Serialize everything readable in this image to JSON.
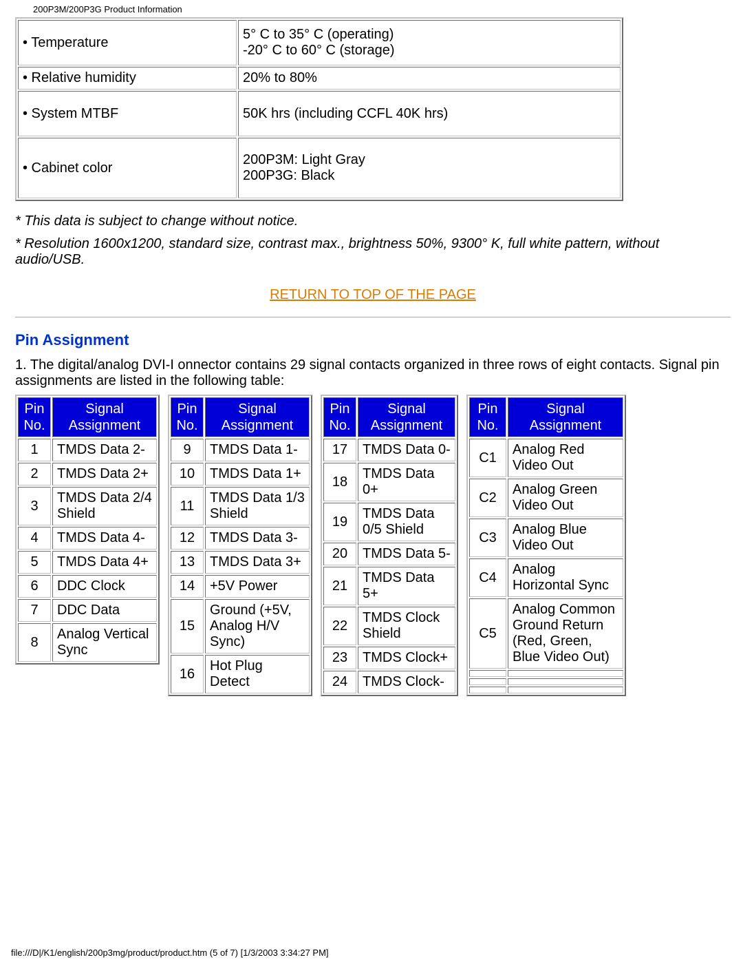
{
  "header": "200P3M/200P3G Product Information",
  "spec_table": {
    "rows": [
      {
        "label": "• Temperature",
        "value": "5° C to 35° C (operating)\n-20° C to 60° C (storage)",
        "cls": "tall"
      },
      {
        "label": "• Relative humidity",
        "value": "20% to 80%",
        "cls": ""
      },
      {
        "label": "• System MTBF",
        "value": "50K hrs (including CCFL 40K hrs)",
        "cls": "tall"
      },
      {
        "label": "• Cabinet color",
        "value": "200P3M: Light Gray\n200P3G: Black",
        "cls": "taller"
      }
    ]
  },
  "notes": [
    "* This data is subject to change without notice.",
    "* Resolution 1600x1200, standard size, contrast max., brightness 50%, 9300° K, full white pattern, without audio/USB."
  ],
  "return_link": "RETURN TO TOP OF THE PAGE",
  "section_title": "Pin Assignment",
  "intro": "1. The digital/analog DVI-I onnector contains 29 signal contacts organized in three rows of eight contacts. Signal pin assignments are listed in the following table:",
  "pin_headers": {
    "no": "Pin No.",
    "sig": "Signal Assignment"
  },
  "pin_cols": [
    [
      {
        "no": "1",
        "sig": "TMDS Data 2-"
      },
      {
        "no": "2",
        "sig": "TMDS Data 2+"
      },
      {
        "no": "3",
        "sig": "TMDS Data 2/4 Shield"
      },
      {
        "no": "4",
        "sig": "TMDS Data 4-"
      },
      {
        "no": "5",
        "sig": "TMDS Data 4+"
      },
      {
        "no": "6",
        "sig": "DDC Clock"
      },
      {
        "no": "7",
        "sig": "DDC Data"
      },
      {
        "no": "8",
        "sig": "Analog Vertical Sync"
      }
    ],
    [
      {
        "no": "9",
        "sig": "TMDS Data 1-"
      },
      {
        "no": "10",
        "sig": "TMDS Data 1+"
      },
      {
        "no": "11",
        "sig": "TMDS Data 1/3 Shield"
      },
      {
        "no": "12",
        "sig": "TMDS Data 3-"
      },
      {
        "no": "13",
        "sig": "TMDS Data 3+"
      },
      {
        "no": "14",
        "sig": "+5V Power"
      },
      {
        "no": "15",
        "sig": "Ground (+5V, Analog H/V Sync)"
      },
      {
        "no": "16",
        "sig": "Hot Plug Detect"
      }
    ],
    [
      {
        "no": "17",
        "sig": "TMDS Data 0-"
      },
      {
        "no": "18",
        "sig": "TMDS Data 0+"
      },
      {
        "no": "19",
        "sig": "TMDS Data 0/5 Shield"
      },
      {
        "no": "20",
        "sig": "TMDS Data 5-"
      },
      {
        "no": "21",
        "sig": "TMDS Data 5+"
      },
      {
        "no": "22",
        "sig": "TMDS Clock Shield"
      },
      {
        "no": "23",
        "sig": "TMDS Clock+"
      },
      {
        "no": "24",
        "sig": "TMDS Clock-"
      }
    ],
    [
      {
        "no": "C1",
        "sig": "Analog Red Video Out"
      },
      {
        "no": "C2",
        "sig": "Analog Green Video Out"
      },
      {
        "no": "C3",
        "sig": "Analog Blue Video Out"
      },
      {
        "no": "C4",
        "sig": "Analog Horizontal Sync"
      },
      {
        "no": "C5",
        "sig": "Analog Common Ground Return (Red, Green, Blue Video Out)"
      },
      {
        "no": "",
        "sig": ""
      },
      {
        "no": "",
        "sig": ""
      },
      {
        "no": "",
        "sig": ""
      }
    ]
  ],
  "footer": "file:///D|/K1/english/200p3mg/product/product.htm (5 of 7) [1/3/2003 3:34:27 PM]"
}
